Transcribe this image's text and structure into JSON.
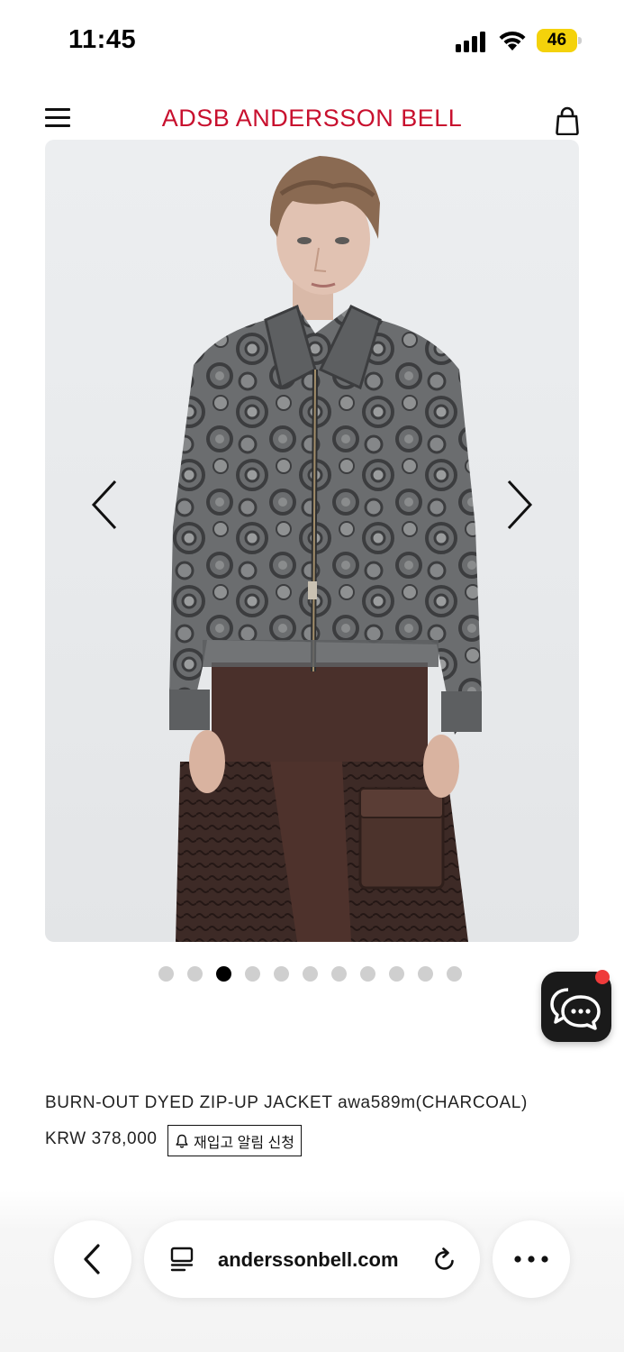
{
  "status_bar": {
    "time": "11:45",
    "battery_level": "46",
    "signal_icon": "cellular-signal-icon",
    "wifi_icon": "wifi-icon"
  },
  "header": {
    "brand": "ADSB ANDERSSON BELL",
    "brand_color": "#c8102e",
    "menu_icon": "hamburger-menu-icon",
    "cart_icon": "shopping-bag-icon"
  },
  "gallery": {
    "prev_icon": "chevron-left-icon",
    "next_icon": "chevron-right-icon",
    "total_images": 11,
    "active_index": 2
  },
  "chat": {
    "icon": "chat-bubbles-icon",
    "badge_color": "#ef3b3b"
  },
  "product": {
    "name": "BURN-OUT DYED ZIP-UP JACKET awa589m(CHARCOAL)",
    "price": "KRW 378,000",
    "restock_label": "재입고 알림 신청",
    "restock_icon": "bell-icon"
  },
  "browser": {
    "url": "anderssonbell.com",
    "back_icon": "chevron-left-icon",
    "tabs_icon": "page-menu-icon",
    "reload_icon": "reload-icon",
    "more_icon": "more-dots-icon"
  }
}
